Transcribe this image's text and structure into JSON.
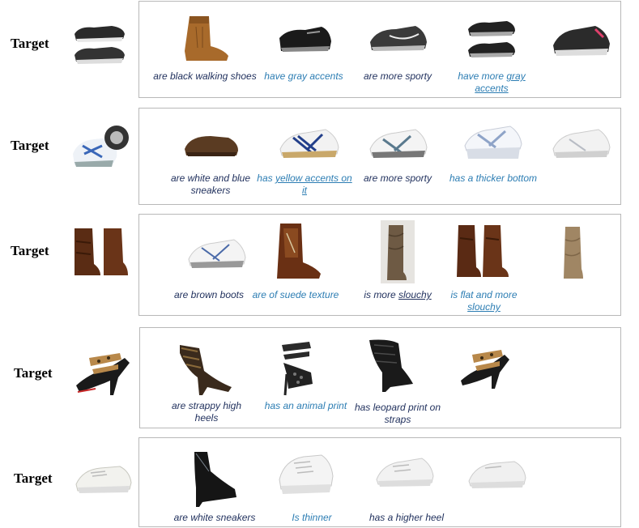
{
  "target_label": "Target",
  "rows": [
    {
      "captions": [
        {
          "parts": [
            "are black walking shoes"
          ],
          "style": "dark"
        },
        {
          "parts": [
            "have gray accents"
          ],
          "style": "blue"
        },
        {
          "parts": [
            "are more sporty"
          ],
          "style": "dark"
        },
        {
          "parts": [
            "have more ",
            "gray",
            " accents"
          ],
          "style": "blue",
          "underline": [
            "gray accents"
          ]
        },
        {
          "parts": [
            ""
          ],
          "style": "dark"
        }
      ]
    },
    {
      "captions": [
        {
          "parts": [
            "are white and blue sneakers"
          ],
          "style": "dark"
        },
        {
          "parts": [
            "has ",
            "yellow accents",
            " on it"
          ],
          "style": "blue",
          "underline": [
            "yellow accents on it"
          ]
        },
        {
          "parts": [
            "are more sporty"
          ],
          "style": "dark"
        },
        {
          "parts": [
            "has a thicker bottom"
          ],
          "style": "blue"
        },
        {
          "parts": [
            ""
          ],
          "style": "dark"
        }
      ]
    },
    {
      "captions": [
        {
          "parts": [
            "are brown boots"
          ],
          "style": "dark"
        },
        {
          "parts": [
            "are of suede texture"
          ],
          "style": "blue"
        },
        {
          "parts": [
            "is more ",
            "slouchy"
          ],
          "style": "dark",
          "underline": [
            "slouchy"
          ]
        },
        {
          "parts": [
            "is flat and more ",
            "slouchy"
          ],
          "style": "blue",
          "underline": [
            "slouchy"
          ]
        },
        {
          "parts": [
            ""
          ],
          "style": "dark"
        }
      ]
    },
    {
      "captions": [
        {
          "parts": [
            "are strappy high heels"
          ],
          "style": "dark"
        },
        {
          "parts": [
            "has an animal print"
          ],
          "style": "blue"
        },
        {
          "parts": [
            "has leopard print on straps"
          ],
          "style": "dark"
        },
        {
          "parts": [
            ""
          ],
          "style": "dark"
        }
      ]
    },
    {
      "captions": [
        {
          "parts": [
            "are white sneakers"
          ],
          "style": "dark"
        },
        {
          "parts": [
            "Is thinner"
          ],
          "style": "blue"
        },
        {
          "parts": [
            "has a higher heel"
          ],
          "style": "dark"
        },
        {
          "parts": [
            ""
          ],
          "style": "dark"
        }
      ]
    }
  ],
  "cap_text": {
    "r0c0": "are black walking shoes",
    "r0c1": "have gray accents",
    "r0c2": "are more sporty",
    "r0c3a": "have more ",
    "r0c3b": "gray accents",
    "r1c0": "are white and blue sneakers",
    "r1c1a": "has ",
    "r1c1b": "yellow accents on it",
    "r1c2": "are more sporty",
    "r1c3": "has a thicker bottom",
    "r2c0": "are brown boots",
    "r2c1": "are of suede texture",
    "r2c2a": "is more ",
    "r2c2b": "slouchy",
    "r2c3a": "is flat and more ",
    "r2c3b": "slouchy",
    "r3c0": "are strappy high heels",
    "r3c1": "has an animal print",
    "r3c2": "has leopard print on straps",
    "r4c0": "are white sneakers",
    "r4c1": "Is thinner",
    "r4c2": "has a higher heel"
  }
}
